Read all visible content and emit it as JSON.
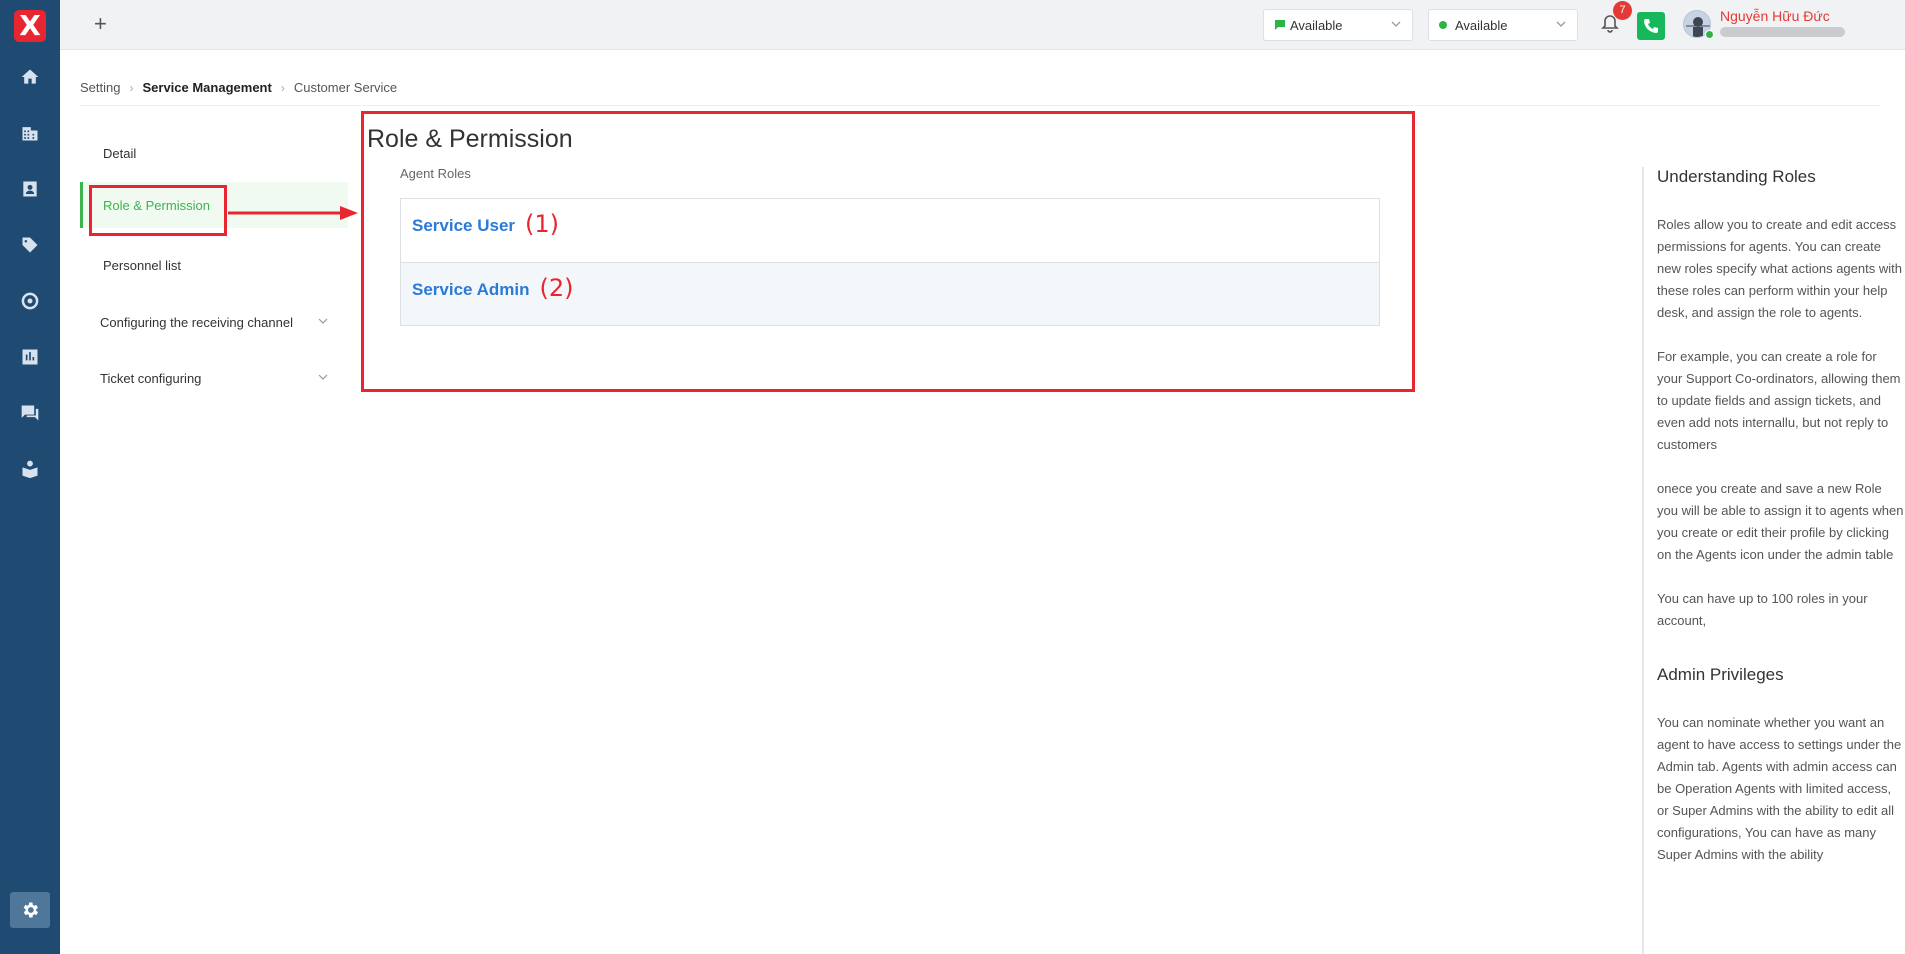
{
  "sidebar": {
    "logo": "X",
    "icons": [
      "home-icon",
      "building-icon",
      "contact-card-icon",
      "tag-icon",
      "target-icon",
      "bar-chart-icon",
      "chat-icon",
      "reader-icon"
    ],
    "active": "gear-icon"
  },
  "topbar": {
    "plus": "+",
    "chat_status": "Available",
    "call_status": "Available",
    "notification_count": "7",
    "user_name": "Nguyễn Hữu Đức",
    "colors": {
      "accent_green": "#3fb34f",
      "phone_green": "#17b85c",
      "red": "#e53935",
      "link_blue": "#2b7ad6"
    }
  },
  "breadcrumb": {
    "items": [
      "Setting",
      "Service Management",
      "Customer Service"
    ]
  },
  "menu": {
    "items": [
      {
        "label": "Detail"
      },
      {
        "label": "Role & Permission"
      },
      {
        "label": "Personnel list"
      },
      {
        "label": "Configuring the receiving channel"
      },
      {
        "label": "Ticket configuring"
      }
    ]
  },
  "main": {
    "title": "Role & Permission",
    "roles_label": "Agent Roles",
    "roles": [
      {
        "name": "Service User",
        "marker": "(1)"
      },
      {
        "name": "Service Admin",
        "marker": "(2)"
      }
    ]
  },
  "help": {
    "title1": "Understanding Roles",
    "p1": "Roles allow you to create and edit access permissions for agents. You can create new roles specify what actions agents with these roles can perform within your help desk, and assign the role to agents.",
    "p2": "For example, you can create a role for your Support Co-ordinators, allowing them to update fields and assign tickets, and even add nots internallu, but not reply to customers",
    "p3": "onece you create and save a new Role you will be able to assign it to agents when you create or edit their profile by clicking on the Agents icon under the admin table",
    "p4": "You can have up to 100 roles in your account,",
    "title2": "Admin Privileges",
    "p5": "You can nominate whether you want an agent to have access to settings under the Admin tab. Agents with admin access can be Operation Agents with limited access, or Super Admins with the ability to edit all configurations, You can have as many Super Admins with the ability"
  }
}
